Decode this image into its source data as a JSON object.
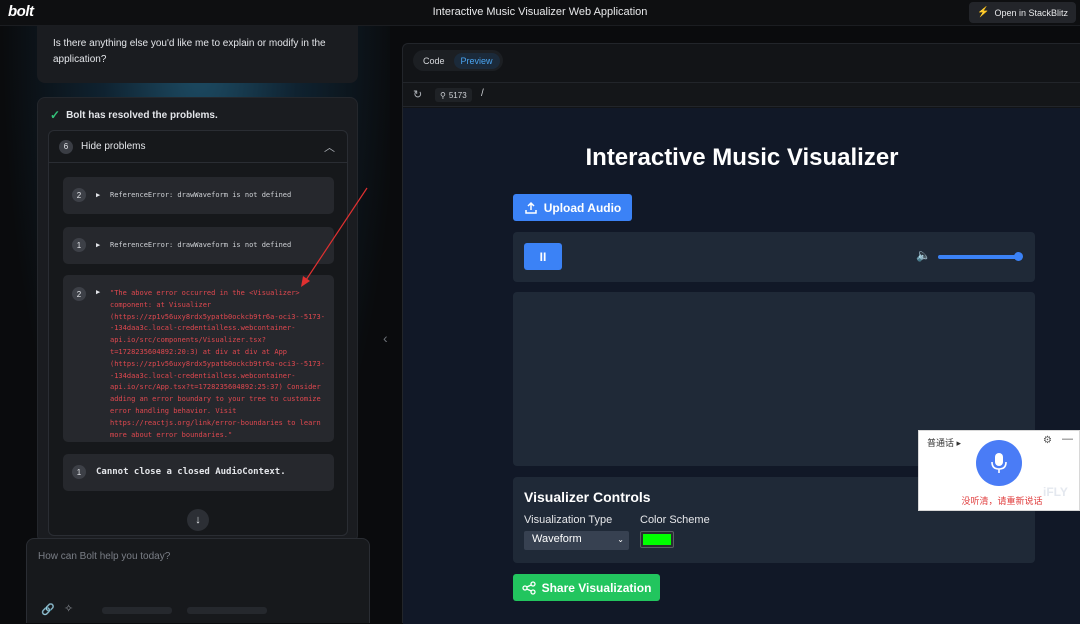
{
  "topbar": {
    "logo": "bolt",
    "title": "Interactive Music Visualizer Web Application",
    "open_button": "Open in StackBlitz"
  },
  "chat": {
    "assistant_message": "Is there anything else you'd like me to explain or modify in the application?",
    "resolved_text": "Bolt has resolved the problems.",
    "problems": {
      "count": "6",
      "toggle_label": "Hide problems",
      "items": [
        {
          "count": "2",
          "text": "ReferenceError: drawWaveform is not defined",
          "color": "#cfd2d6"
        },
        {
          "count": "1",
          "text": "ReferenceError: drawWaveform is not defined",
          "color": "#cfd2d6"
        },
        {
          "count": "2",
          "text": "\"The above error occurred in the <Visualizer> component: at Visualizer (https://zp1v56uxy8rdx5ypatb0ockcb9tr6a-oci3--5173--134daa3c.local-credentialless.webcontainer-api.io/src/components/Visualizer.tsx?t=1728235604892:20:3) at div at div at App (https://zp1v56uxy8rdx5ypatb0ockcb9tr6a-oci3--5173--134daa3c.local-credentialless.webcontainer-api.io/src/App.tsx?t=1728235604892:25:37) Consider adding an error boundary to your tree to customize error handling behavior. Visit https://reactjs.org/link/error-boundaries to learn more about error boundaries.\"",
          "color": "#e0484f"
        },
        {
          "count": "1",
          "text": "Cannot close a closed AudioContext.",
          "color": "#e4e6ea"
        }
      ]
    },
    "input_placeholder": "How can Bolt help you today?"
  },
  "preview": {
    "tabs": [
      {
        "label": "Code",
        "active": false
      },
      {
        "label": "Preview",
        "active": true
      }
    ],
    "port": "5173",
    "path": "/",
    "app": {
      "title": "Interactive Music Visualizer",
      "upload_label": "Upload Audio",
      "pause_label": "II",
      "volume_level": 1.0,
      "controls_title": "Visualizer Controls",
      "type_label": "Visualization Type",
      "type_value": "Waveform",
      "color_label": "Color Scheme",
      "color_value": "#00ff00",
      "share_label": "Share Visualization"
    }
  },
  "voice_popup": {
    "language": "普通话",
    "status": "没听清，请重新说话",
    "watermark": "iFLY"
  },
  "colors": {
    "accent_blue": "#3b82f6",
    "accent_green": "#22c55e",
    "error_red": "#e0484f"
  }
}
